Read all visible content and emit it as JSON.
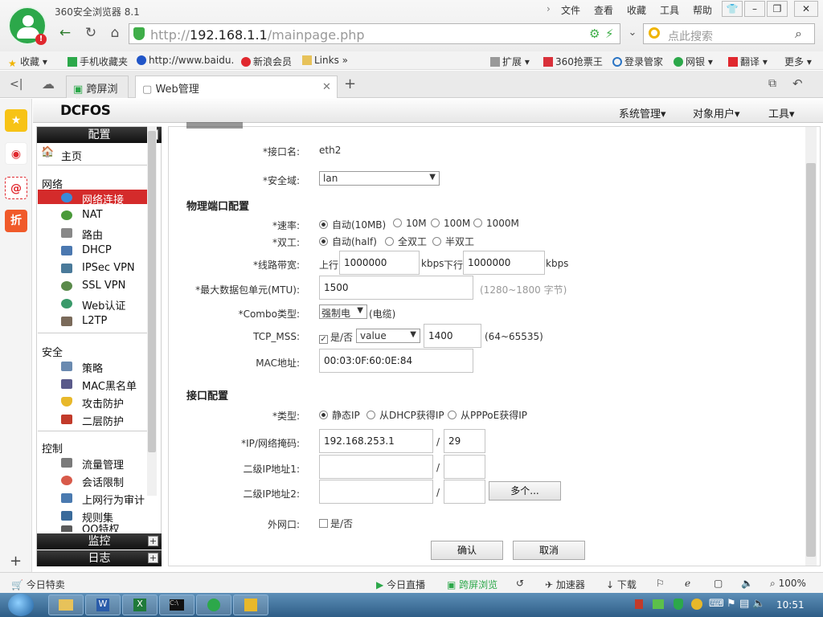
{
  "app": {
    "title": "360安全浏览器 8.1"
  },
  "menu": [
    "文件",
    "查看",
    "收藏",
    "工具",
    "帮助"
  ],
  "address": {
    "prefix": "http://",
    "host": "192.168.1.1",
    "path": "/mainpage.php",
    "search_placeholder": "点此搜索"
  },
  "bookmarks": [
    "收藏",
    "手机收藏夹",
    "http://www.baidu.",
    "新浪会员",
    "Links",
    "扩展",
    "360抢票王",
    "登录管家",
    "网银",
    "翻译",
    "更多"
  ],
  "tabs": [
    {
      "label": "跨屏浏览"
    },
    {
      "label": "Web管理"
    }
  ],
  "page": {
    "brand": "DCFOS",
    "topmenu": [
      "系统管理▾",
      "对象用户▾",
      "工具▾"
    ],
    "nav": {
      "header": "配置",
      "home": "主页",
      "sections": [
        {
          "title": "网络",
          "items": [
            "网络连接",
            "NAT",
            "路由",
            "DHCP",
            "IPSec VPN",
            "SSL VPN",
            "Web认证",
            "L2TP"
          ]
        },
        {
          "title": "安全",
          "items": [
            "策略",
            "MAC黑名单",
            "攻击防护",
            "二层防护"
          ]
        },
        {
          "title": "控制",
          "items": [
            "流量管理",
            "会话限制",
            "上网行为审计",
            "规则集",
            "QQ特权"
          ]
        }
      ],
      "footer": [
        "监控",
        "日志"
      ]
    },
    "form": {
      "ifname_label": "*接口名:",
      "ifname_value": "eth2",
      "zone_label": "*安全域:",
      "zone_value": "lan",
      "phys_title": "物理端口配置",
      "speed_label": "*速率:",
      "speed_options": [
        "自动(10MB)",
        "10M",
        "100M",
        "1000M"
      ],
      "duplex_label": "*双工:",
      "duplex_options": [
        "自动(half)",
        "全双工",
        "半双工"
      ],
      "bw_label": "*线路带宽:",
      "bw_up_label": "上行",
      "bw_up": "1000000",
      "bw_unit": "kbps",
      "bw_down_label": "下行",
      "bw_down": "1000000",
      "bw_unit2": "kbps",
      "mtu_label": "*最大数据包单元(MTU):",
      "mtu_value": "1500",
      "mtu_hint": "(1280~1800 字节)",
      "combo_label": "*Combo类型:",
      "combo_value": "强制电",
      "combo_hint": "(电缆)",
      "mss_label": "TCP_MSS:",
      "mss_check": "是/否",
      "mss_select": "value",
      "mss_value": "1400",
      "mss_hint": "(64~65535)",
      "mac_label": "MAC地址:",
      "mac_value": "00:03:0F:60:0E:84",
      "if_title": "接口配置",
      "type_label": "*类型:",
      "type_options": [
        "静态IP",
        "从DHCP获得IP",
        "从PPPoE获得IP"
      ],
      "ip_label": "*IP/网络掩码:",
      "ip_value": "192.168.253.1",
      "mask_value": "29",
      "ip2_label": "二级IP地址1:",
      "ip3_label": "二级IP地址2:",
      "slash": "/",
      "more_button": "多个...",
      "wan_label": "外网口:",
      "wan_check": "是/否",
      "confirm": "确认",
      "cancel": "取消"
    }
  },
  "status": {
    "left": "今日特卖",
    "items": [
      "今日直播",
      "跨屏浏览",
      "加速器",
      "下载"
    ],
    "zoom": "100%"
  },
  "taskbar": {
    "clock": "10:51"
  }
}
